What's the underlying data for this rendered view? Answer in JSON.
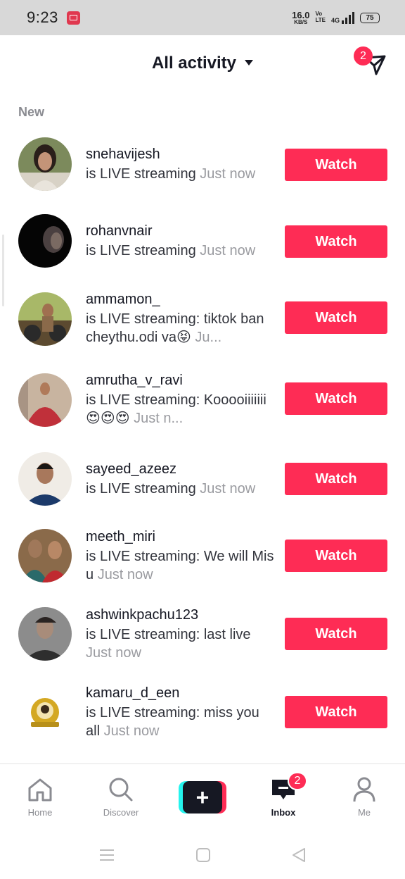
{
  "status_bar": {
    "time": "9:23",
    "net_speed_value": "16.0",
    "net_speed_unit": "KB/S",
    "volte_top": "Vo",
    "volte_bottom": "LTE",
    "network": "4G",
    "battery": "75"
  },
  "header": {
    "title": "All activity",
    "dm_badge": "2"
  },
  "section_label": "New",
  "activities": [
    {
      "username": "snehavijesh",
      "text": "is LIVE streaming",
      "time": "Just now",
      "button": "Watch"
    },
    {
      "username": "rohanvnair",
      "text": "is LIVE streaming",
      "time": "Just now",
      "button": "Watch"
    },
    {
      "username": "ammamon_",
      "text": "is LIVE streaming: tiktok ban cheythu.odi va😝",
      "time": "Ju...",
      "button": "Watch"
    },
    {
      "username": "amrutha_v_ravi",
      "text": "is LIVE streaming: Kooooiiiiiii😍😍😍",
      "time": "Just n...",
      "button": "Watch"
    },
    {
      "username": "sayeed_azeez",
      "text": "is LIVE streaming",
      "time": "Just now",
      "button": "Watch"
    },
    {
      "username": "meeth_miri",
      "text": "is LIVE streaming: We will Mis u",
      "time": "Just now",
      "button": "Watch"
    },
    {
      "username": "ashwinkpachu123",
      "text": "is LIVE streaming: last live",
      "time": "Just now",
      "button": "Watch"
    },
    {
      "username": "kamaru_d_een",
      "text": "is LIVE streaming: miss you all",
      "time": "Just now",
      "button": "Watch"
    }
  ],
  "bottom_nav": {
    "home": "Home",
    "discover": "Discover",
    "create_symbol": "+",
    "inbox": "Inbox",
    "inbox_badge": "2",
    "me": "Me"
  },
  "colors": {
    "accent": "#fe2c55",
    "cyan": "#25f4ee",
    "text": "#161823",
    "muted": "#8a8b91"
  }
}
